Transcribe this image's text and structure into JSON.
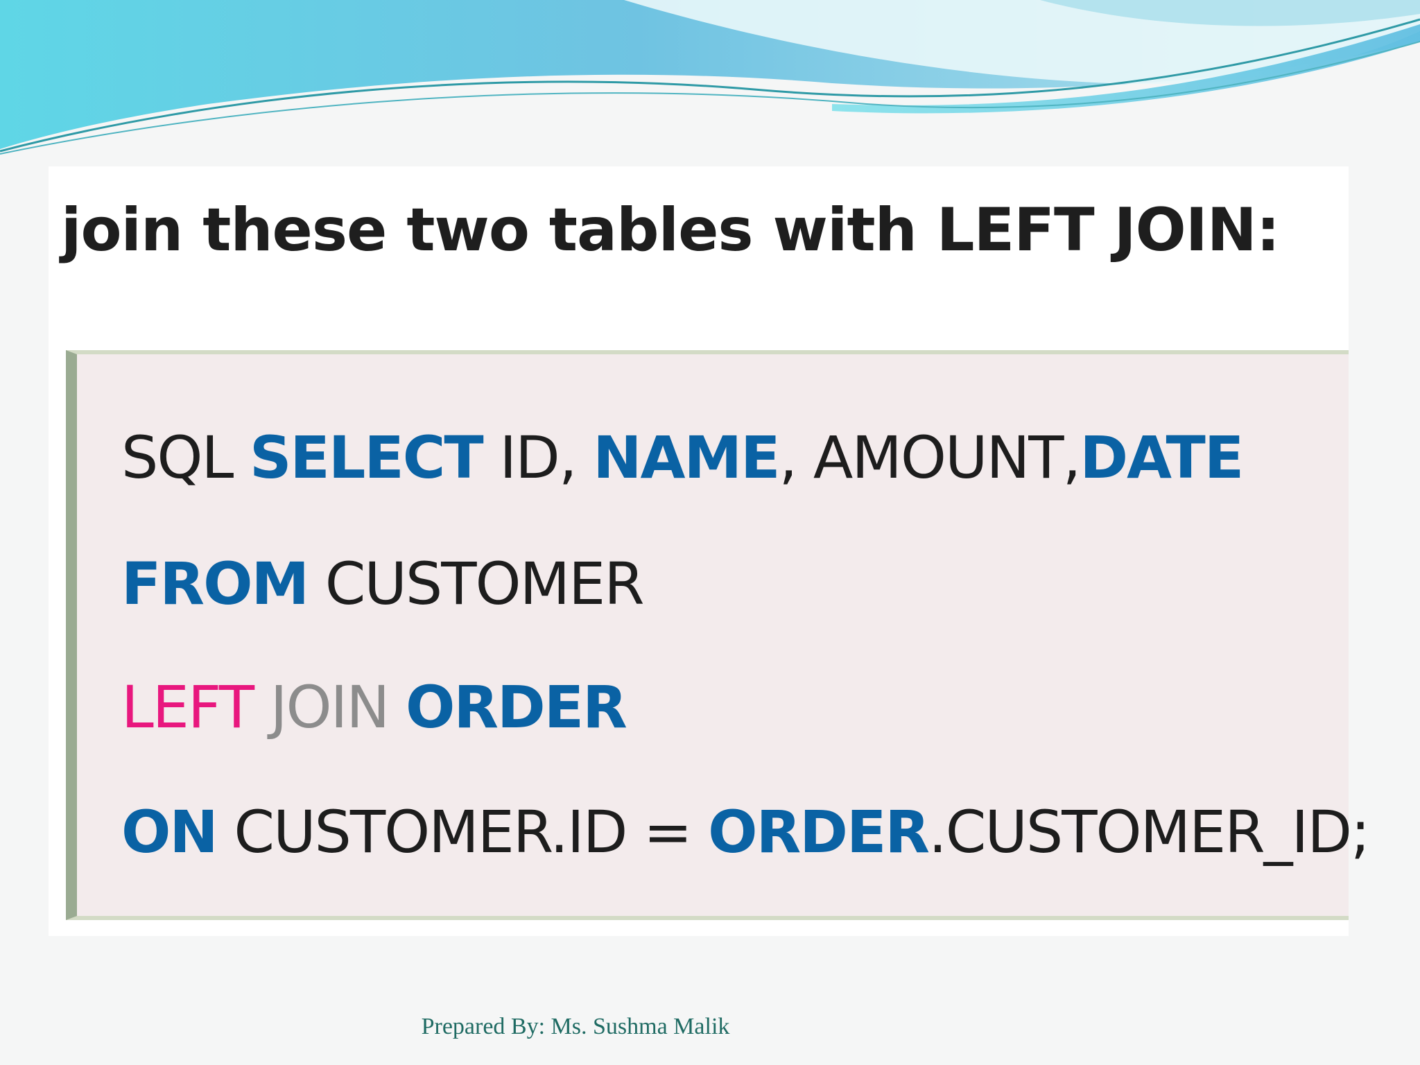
{
  "slide": {
    "heading": "join these two tables with LEFT JOIN:",
    "footer": "Prepared By: Ms. Sushma Malik"
  },
  "code": {
    "line1": {
      "sql": "SQL ",
      "select": "SELECT",
      "id": " ID, ",
      "name": "NAME",
      "amount": ", AMOUNT,",
      "date": "DATE"
    },
    "line2": {
      "from": "FROM",
      "customer": " CUSTOMER"
    },
    "line3": {
      "left": "LEFT",
      "join": " JOIN ",
      "order": "ORDER"
    },
    "line4": {
      "on": "ON",
      "condition": " CUSTOMER.ID = ",
      "order": "ORDER",
      "rest": ".CUSTOMER_ID;"
    }
  },
  "colors": {
    "keyword": "#0a62a4",
    "left_keyword": "#e8177e",
    "join_keyword": "#8c8c8c",
    "code_background": "#f3ebec",
    "footer_text": "#1f6b63"
  }
}
